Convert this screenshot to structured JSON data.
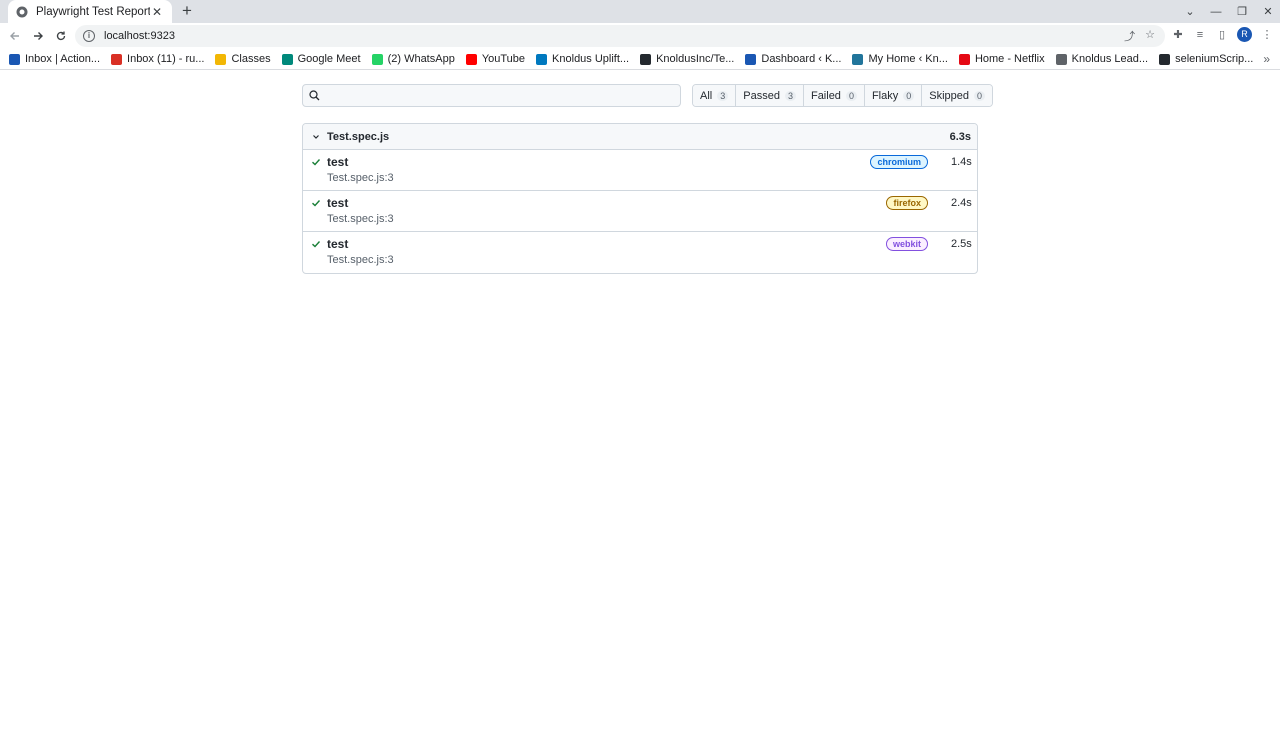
{
  "browser": {
    "tab_title": "Playwright Test Report",
    "url": "localhost:9323",
    "avatar_letter": "R"
  },
  "bookmarks": [
    {
      "label": "Inbox | Action...",
      "icon": "k-icon",
      "color": "#1a57b3"
    },
    {
      "label": "Inbox (11) - ru...",
      "icon": "gmail-icon",
      "color": "#d93025"
    },
    {
      "label": "Classes",
      "icon": "classroom-icon",
      "color": "#f2b705"
    },
    {
      "label": "Google Meet",
      "icon": "meet-icon",
      "color": "#00897b"
    },
    {
      "label": "(2) WhatsApp",
      "icon": "whatsapp-icon",
      "color": "#25d366"
    },
    {
      "label": "YouTube",
      "icon": "youtube-icon",
      "color": "#ff0000"
    },
    {
      "label": "Knoldus Uplift...",
      "icon": "trello-icon",
      "color": "#0079bf"
    },
    {
      "label": "KnoldusInc/Te...",
      "icon": "github-icon",
      "color": "#24292f"
    },
    {
      "label": "Dashboard ‹ K...",
      "icon": "dashboard-icon",
      "color": "#1a57b3"
    },
    {
      "label": "My Home ‹ Kn...",
      "icon": "wordpress-icon",
      "color": "#21759b"
    },
    {
      "label": "Home - Netflix",
      "icon": "netflix-icon",
      "color": "#e50914"
    },
    {
      "label": "Knoldus Lead...",
      "icon": "globe-icon",
      "color": "#5f6368"
    },
    {
      "label": "seleniumScrip...",
      "icon": "github-icon",
      "color": "#24292f"
    }
  ],
  "report": {
    "search_placeholder": "",
    "filters": [
      {
        "label": "All",
        "count": "3"
      },
      {
        "label": "Passed",
        "count": "3"
      },
      {
        "label": "Failed",
        "count": "0"
      },
      {
        "label": "Flaky",
        "count": "0"
      },
      {
        "label": "Skipped",
        "count": "0"
      }
    ],
    "file": {
      "name": "Test.spec.js",
      "duration": "6.3s"
    },
    "tests": [
      {
        "title": "test",
        "project": "chromium",
        "duration": "1.4s",
        "location": "Test.spec.js:3",
        "badge_bg": "#ddf4ff",
        "badge_fg": "#0969da"
      },
      {
        "title": "test",
        "project": "firefox",
        "duration": "2.4s",
        "location": "Test.spec.js:3",
        "badge_bg": "#fff8c5",
        "badge_fg": "#9a6700"
      },
      {
        "title": "test",
        "project": "webkit",
        "duration": "2.5s",
        "location": "Test.spec.js:3",
        "badge_bg": "#fbefff",
        "badge_fg": "#8250df"
      }
    ]
  },
  "colors": {
    "passed_check": "#1a7f37",
    "border": "#d0d7de"
  }
}
